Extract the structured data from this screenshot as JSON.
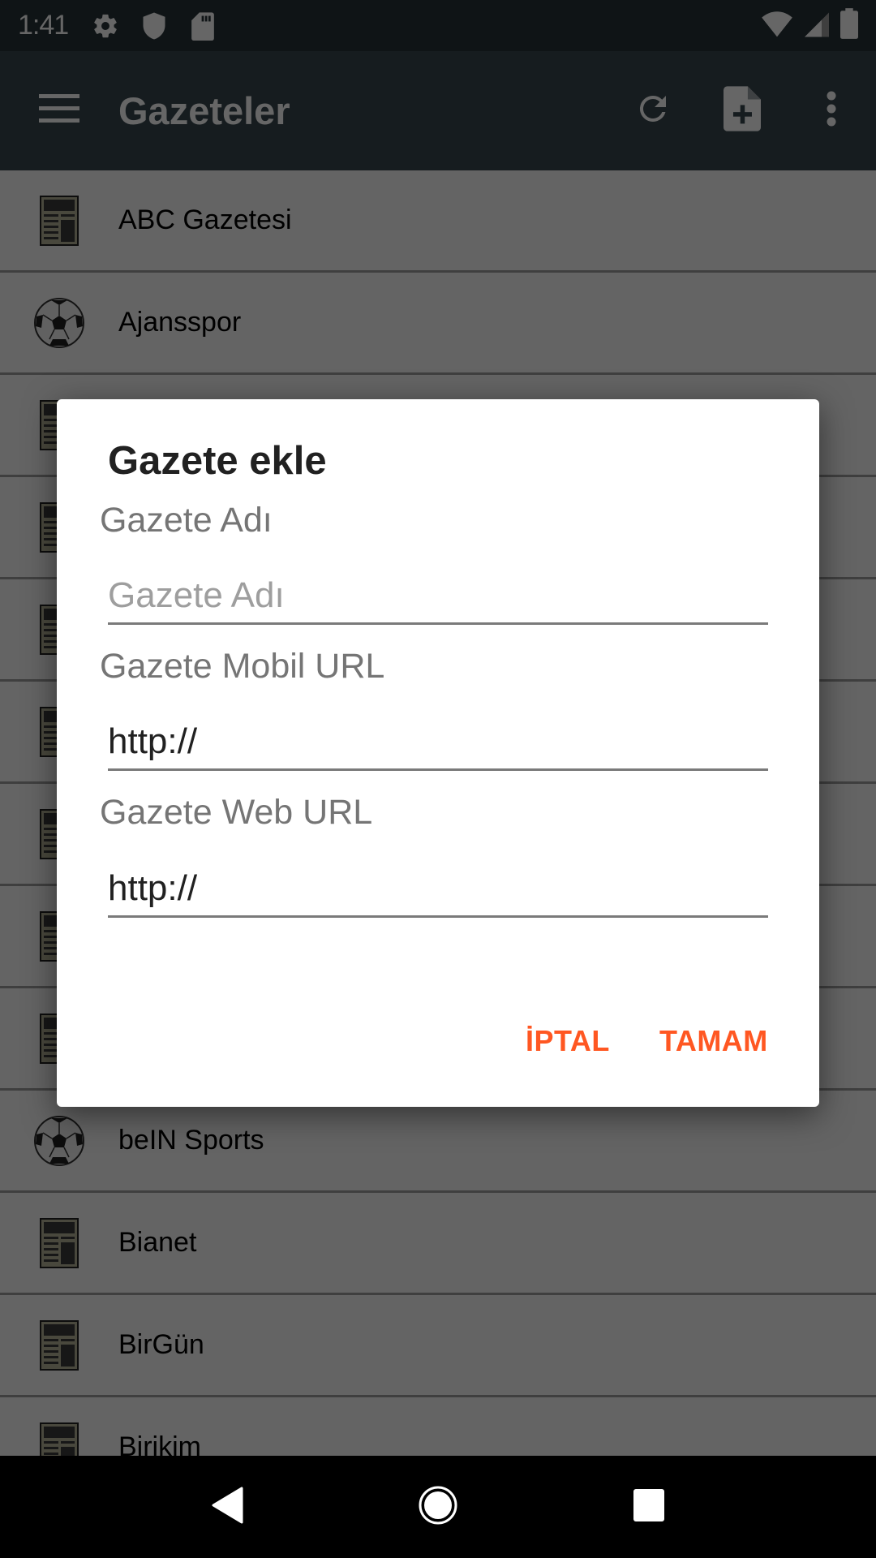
{
  "status_bar": {
    "time": "1:41",
    "left_icons": [
      "gear-icon",
      "shield-icon",
      "sd-card-icon"
    ],
    "right_icons": [
      "wifi-icon",
      "cell-signal-icon",
      "battery-icon"
    ]
  },
  "app_bar": {
    "title": "Gazeteler",
    "menu_icon": "hamburger-menu-icon",
    "actions": [
      {
        "name": "refresh",
        "icon": "refresh-icon"
      },
      {
        "name": "add-newspaper",
        "icon": "note-add-icon"
      },
      {
        "name": "overflow",
        "icon": "more-vert-icon"
      }
    ]
  },
  "list": {
    "items": [
      {
        "label": "ABC Gazetesi",
        "icon": "newspaper-icon"
      },
      {
        "label": "Ajansspor",
        "icon": "soccer-ball-icon"
      },
      {
        "label": "",
        "icon": "newspaper-icon"
      },
      {
        "label": "",
        "icon": "newspaper-icon"
      },
      {
        "label": "",
        "icon": "newspaper-icon"
      },
      {
        "label": "",
        "icon": "newspaper-icon"
      },
      {
        "label": "",
        "icon": "newspaper-icon"
      },
      {
        "label": "",
        "icon": "newspaper-icon"
      },
      {
        "label": "",
        "icon": "newspaper-icon"
      },
      {
        "label": "beIN Sports",
        "icon": "soccer-ball-icon"
      },
      {
        "label": "Bianet",
        "icon": "newspaper-icon"
      },
      {
        "label": "BirGün",
        "icon": "newspaper-icon"
      },
      {
        "label": "Birikim",
        "icon": "newspaper-icon"
      }
    ]
  },
  "dialog": {
    "title": "Gazete ekle",
    "fields": [
      {
        "label": "Gazete Adı",
        "value": "",
        "placeholder": "Gazete Adı"
      },
      {
        "label": "Gazete Mobil URL",
        "value": "http://",
        "placeholder": ""
      },
      {
        "label": "Gazete Web URL",
        "value": "http://",
        "placeholder": ""
      }
    ],
    "cancel_label": "İPTAL",
    "ok_label": "TAMAM",
    "accent_color": "#ff5722"
  },
  "nav_bar": {
    "buttons": [
      "back-icon",
      "home-icon",
      "recents-icon"
    ]
  }
}
